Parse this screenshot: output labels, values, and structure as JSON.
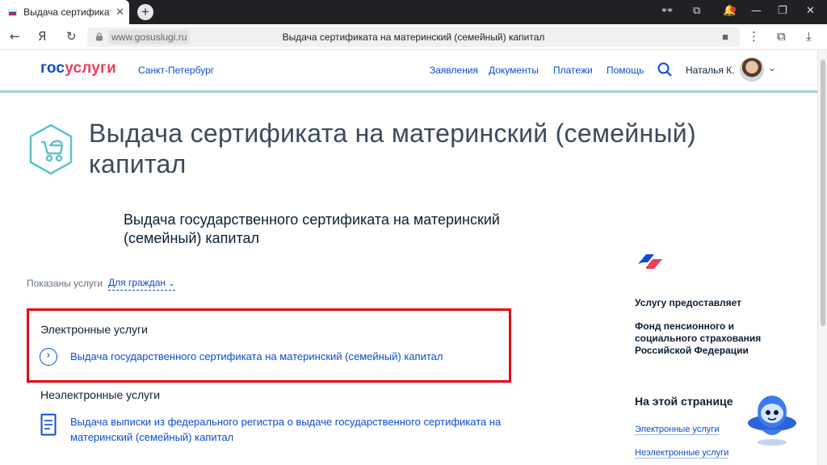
{
  "browser": {
    "tab_title": "Выдача сертификата на матер",
    "tab_close": "✕",
    "new_tab": "+",
    "domain": "www.gosuslugi.ru",
    "page_title": "Выдача сертификата на материнский (семейный) капитал"
  },
  "header": {
    "logo_gos": "гос",
    "logo_uslugi": "услуги",
    "region": "Санкт-Петербург",
    "nav": [
      "Заявления",
      "Документы",
      "Платежи",
      "Помощь"
    ],
    "user_name": "Наталья К."
  },
  "main": {
    "title": "Выдача сертификата на материнский (семейный) капитал",
    "subtitle": "Выдача государственного сертификата на материнский (семейный) капитал",
    "filter_label": "Показаны услуги",
    "filter_value": "Для граждан",
    "electronic_heading": "Электронные услуги",
    "electronic_link": "Выдача государственного сертификата на материнский (семейный) капитал",
    "nonelectronic_heading": "Неэлектронные услуги",
    "nonelectronic_link": "Выдача выписки из федерального регистра о выдаче государственного сертификата на материнский (семейный) капитал"
  },
  "sidebar": {
    "provider_heading": "Услугу предоставляет",
    "provider_name": "Фонд пенсионного и социального страхования Российской Федерации",
    "onpage_heading": "На этой странице",
    "onpage_links": [
      "Электронные услуги",
      "Неэлектронные услуги"
    ]
  },
  "colors": {
    "accent": "#0d4cd3",
    "brand_red": "#ee3f58",
    "highlight": "#e30613",
    "teal": "#9cd3d8"
  }
}
